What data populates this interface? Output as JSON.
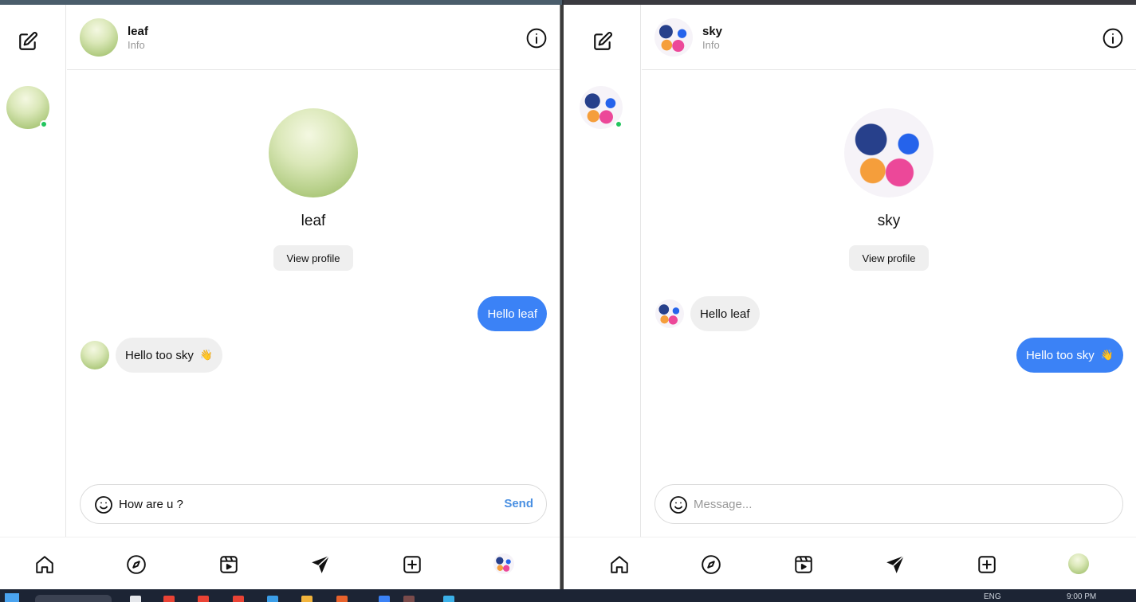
{
  "left_window": {
    "contact": {
      "name": "leaf",
      "subtitle": "Info"
    },
    "profile": {
      "name": "leaf",
      "view_profile_label": "View profile"
    },
    "messages": [
      {
        "direction": "outgoing",
        "text": "Hello leaf"
      },
      {
        "direction": "incoming",
        "text": "Hello too sky",
        "emoji": "👋"
      }
    ],
    "composer": {
      "value": "How are u ?",
      "placeholder": "Message...",
      "send_label": "Send"
    }
  },
  "right_window": {
    "contact": {
      "name": "sky",
      "subtitle": "Info"
    },
    "profile": {
      "name": "sky",
      "view_profile_label": "View profile"
    },
    "messages": [
      {
        "direction": "incoming",
        "text": "Hello leaf"
      },
      {
        "direction": "outgoing",
        "text": "Hello too sky",
        "emoji": "👋"
      }
    ],
    "composer": {
      "value": "",
      "placeholder": "Message..."
    }
  },
  "nav_icons": [
    "home-icon",
    "explore-icon",
    "reels-icon",
    "direct-icon",
    "create-icon",
    "profile-avatar"
  ],
  "taskbar": {
    "lang": "ENG",
    "time": "9:00 PM"
  },
  "colors": {
    "accent": "#3b82f6",
    "send_text": "#4a90e2",
    "online": "#22c55e",
    "incoming_bubble": "#efefef"
  }
}
